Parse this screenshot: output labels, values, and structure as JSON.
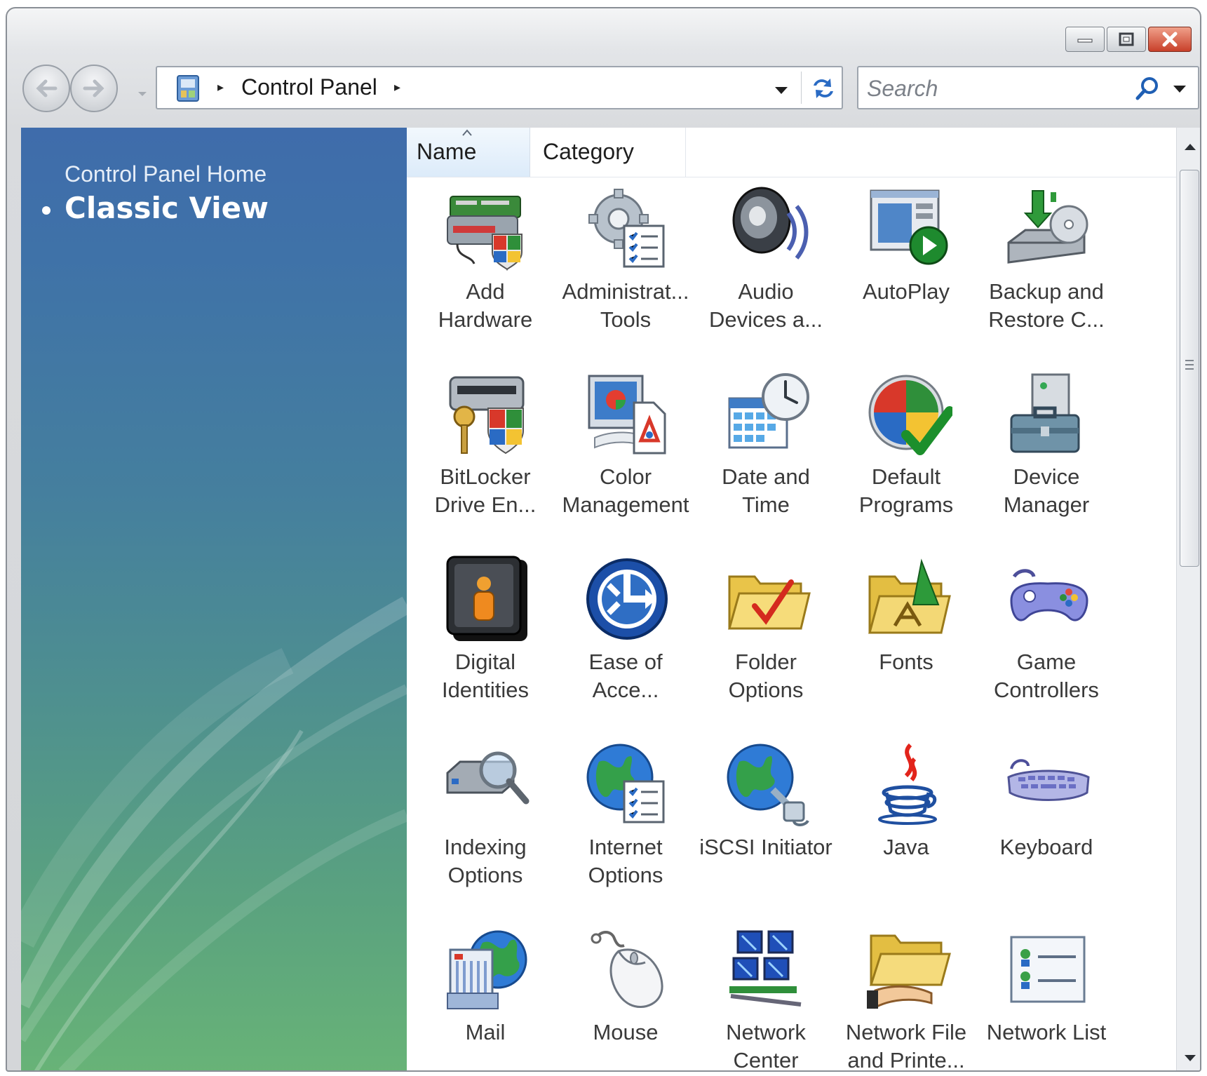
{
  "window": {
    "caption_buttons": [
      "minimize",
      "maximize",
      "close"
    ]
  },
  "navigation": {
    "back_icon": "back-arrow-icon",
    "forward_icon": "forward-arrow-icon"
  },
  "address": {
    "path": "Control Panel",
    "separator": "▸"
  },
  "search": {
    "placeholder": "Search"
  },
  "left_pane": {
    "home_link": "Control Panel Home",
    "classic_view": "Classic View"
  },
  "columns": {
    "name": "Name",
    "category": "Category"
  },
  "items": [
    {
      "label": "Add\nHardware",
      "icon": "add-hardware-icon"
    },
    {
      "label": "Administrat...\nTools",
      "icon": "administrative-tools-icon"
    },
    {
      "label": "Audio\nDevices a...",
      "icon": "audio-devices-icon"
    },
    {
      "label": "AutoPlay",
      "icon": "autoplay-icon"
    },
    {
      "label": "Backup and\nRestore C...",
      "icon": "backup-restore-icon"
    },
    {
      "label": "BitLocker\nDrive En...",
      "icon": "bitlocker-icon"
    },
    {
      "label": "Color\nManagement",
      "icon": "color-management-icon"
    },
    {
      "label": "Date and\nTime",
      "icon": "date-time-icon"
    },
    {
      "label": "Default\nPrograms",
      "icon": "default-programs-icon"
    },
    {
      "label": "Device\nManager",
      "icon": "device-manager-icon"
    },
    {
      "label": "Digital\nIdentities",
      "icon": "digital-identities-icon"
    },
    {
      "label": "Ease of\nAcce...",
      "icon": "ease-of-access-icon"
    },
    {
      "label": "Folder\nOptions",
      "icon": "folder-options-icon"
    },
    {
      "label": "Fonts",
      "icon": "fonts-icon"
    },
    {
      "label": "Game\nControllers",
      "icon": "game-controllers-icon"
    },
    {
      "label": "Indexing\nOptions",
      "icon": "indexing-options-icon"
    },
    {
      "label": "Internet\nOptions",
      "icon": "internet-options-icon"
    },
    {
      "label": "iSCSI Initiator",
      "icon": "iscsi-initiator-icon"
    },
    {
      "label": "Java",
      "icon": "java-icon"
    },
    {
      "label": "Keyboard",
      "icon": "keyboard-icon"
    },
    {
      "label": "Mail",
      "icon": "mail-icon"
    },
    {
      "label": "Mouse",
      "icon": "mouse-icon"
    },
    {
      "label": "Network\nCenter",
      "icon": "network-center-icon"
    },
    {
      "label": "Network File\nand Printe...",
      "icon": "network-file-printer-icon"
    },
    {
      "label": "Network List",
      "icon": "network-list-icon"
    }
  ]
}
